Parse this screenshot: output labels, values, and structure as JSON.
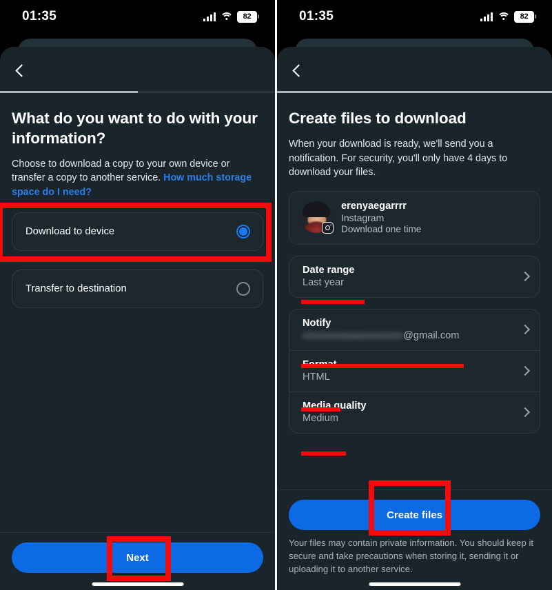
{
  "status_bar": {
    "time": "01:35",
    "battery_level": "82",
    "signal_icon": "cellular-signal-icon",
    "wifi_icon": "wifi-icon",
    "battery_icon": "battery-icon"
  },
  "colors": {
    "accent_blue": "#0b6ae4",
    "link_blue": "#2a7fe8",
    "radio_selected": "#1877f2",
    "annotation_red": "#f40c0c",
    "sheet_bg": "#1a242b",
    "card_bg": "#1d272e",
    "card_border": "#2b3940"
  },
  "left_screen": {
    "back_icon": "chevron-left-icon",
    "progress_percent": 50,
    "title": "What do you want to do with your information?",
    "subtitle_text": "Choose to download a copy to your own device or transfer a copy to another service. ",
    "subtitle_link": "How much storage space do I need?",
    "options": [
      {
        "label": "Download to device",
        "selected": true
      },
      {
        "label": "Transfer to destination",
        "selected": false
      }
    ],
    "cta_label": "Next"
  },
  "right_screen": {
    "back_icon": "chevron-left-icon",
    "progress_percent": 100,
    "title": "Create files to download",
    "subtitle": "When your download is ready, we'll send you a notification. For security, you'll only have 4 days to download your files.",
    "account": {
      "username": "erenyaegarrrr",
      "service": "Instagram",
      "frequency": "Download one time",
      "avatar_icon": "avatar",
      "badge_icon": "instagram-badge-icon"
    },
    "date_range": {
      "label": "Date range",
      "value": "Last year",
      "chevron_icon": "chevron-right-icon"
    },
    "settings": [
      {
        "label": "Notify",
        "value_redacted": "aaaaaaaaaaaaaaaaaa",
        "value_suffix": "@gmail.com",
        "chevron_icon": "chevron-right-icon"
      },
      {
        "label": "Format",
        "value": "HTML",
        "chevron_icon": "chevron-right-icon"
      },
      {
        "label": "Media quality",
        "value": "Medium",
        "chevron_icon": "chevron-right-icon"
      }
    ],
    "cta_label": "Create files",
    "footer_note": "Your files may contain private information. You should keep it secure and take precautions when storing it, sending it or uploading it to another service."
  },
  "annotations": {
    "download_to_device_box": "highlight-box-download-to-device",
    "next_button_box": "highlight-box-next-button",
    "create_files_box": "highlight-box-create-files",
    "date_range_underline": "underline-last-year",
    "notify_underline": "underline-notify-email",
    "format_underline": "underline-html",
    "media_quality_underline": "underline-medium"
  }
}
